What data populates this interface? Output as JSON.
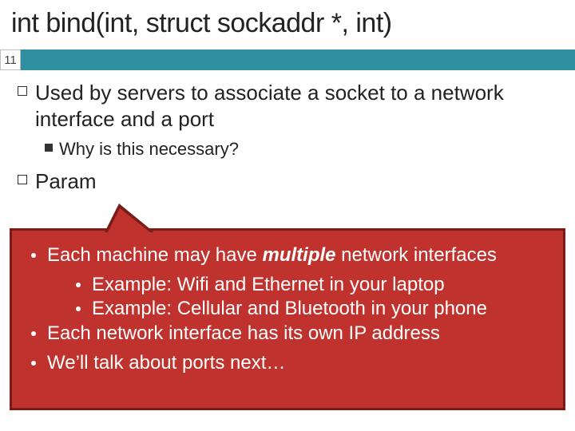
{
  "page_number": "11",
  "title": "int bind(int, struct sockaddr *, int)",
  "body": {
    "item1": "Used by servers to associate a socket to a network interface and a port",
    "item1_sub1_a": "Why",
    "item1_sub1_b": " is this necessary?",
    "item2": "Param"
  },
  "callout": {
    "l1_a": "Each machine may have ",
    "l1_em": "multiple",
    "l1_b": " network interfaces",
    "l1_sub1": "Example: Wifi and Ethernet in your laptop",
    "l1_sub2": "Example: Cellular and Bluetooth in your phone",
    "l2": "Each network interface has its own IP address",
    "l3": "We’ll talk about ports next…"
  }
}
